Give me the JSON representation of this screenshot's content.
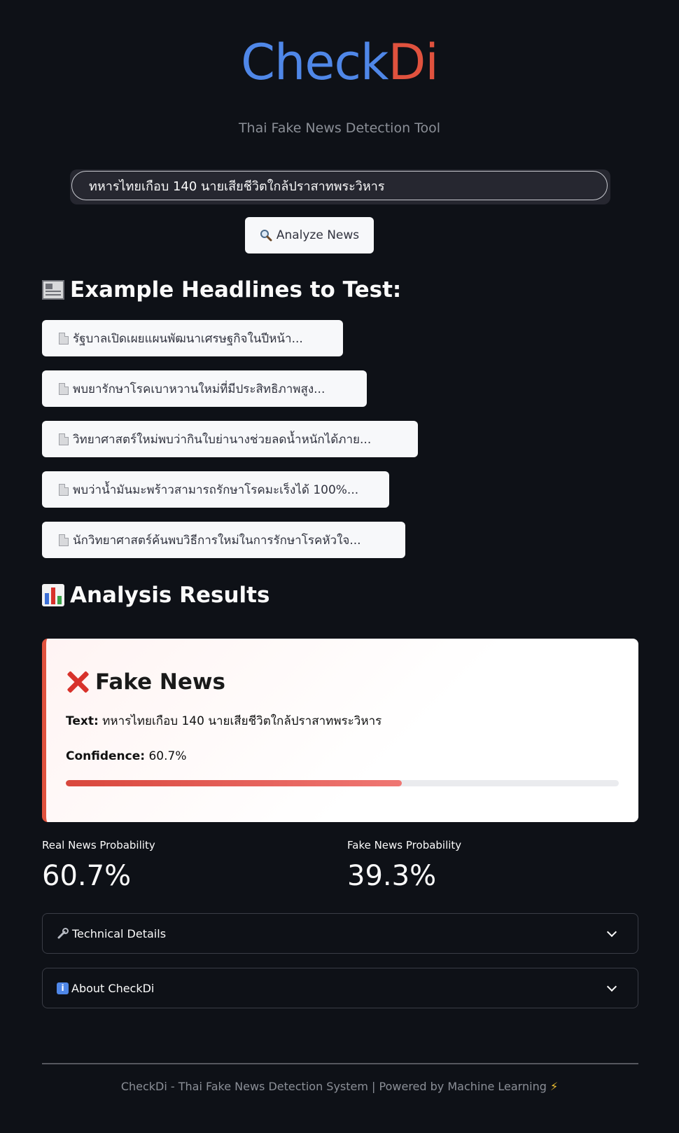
{
  "header": {
    "logo_part1": "Check",
    "logo_part2": "Di",
    "subtitle": "Thai Fake News Detection Tool",
    "logo_colors": {
      "check": "#4f87e8",
      "di": "#e0523e"
    }
  },
  "search": {
    "value": "ทหารไทยเกือบ 140 นายเสียชีวิตใกล้ปราสาทพระวิหาร"
  },
  "analyze_button": {
    "icon": "magnifier-icon",
    "label": "Analyze News"
  },
  "examples": {
    "title": "Example Headlines to Test:",
    "icon": "newspaper-icon",
    "items": [
      {
        "icon": "document-icon",
        "label": "รัฐบาลเปิดเผยแผนพัฒนาเศรษฐกิจในปีหน้า..."
      },
      {
        "icon": "document-icon",
        "label": "พบยารักษาโรคเบาหวานใหม่ที่มีประสิทธิภาพสูง..."
      },
      {
        "icon": "document-icon",
        "label": "วิทยาศาสตร์ใหม่พบว่ากินใบย่านางช่วยลดน้ำหนักได้ภาย..."
      },
      {
        "icon": "document-icon",
        "label": "พบว่าน้ำมันมะพร้าวสามารถรักษาโรคมะเร็งได้ 100%..."
      },
      {
        "icon": "document-icon",
        "label": "นักวิทยาศาสตร์ค้นพบวิธีการใหม่ในการรักษาโรคหัวใจ..."
      }
    ]
  },
  "results": {
    "title": "Analysis Results",
    "icon": "bar-chart-icon",
    "verdict": "Fake News",
    "verdict_icon": "cross-mark-icon",
    "text_label": "Text:",
    "text_value": "ทหารไทยเกือบ 140 นายเสียชีวิตใกล้ปราสาทพระวิหาร",
    "confidence_label": "Confidence:",
    "confidence_value": "60.7%",
    "confidence_fraction": 0.607,
    "accent_color": "#e0523e"
  },
  "metrics": {
    "real_label": "Real News Probability",
    "real_value": "60.7%",
    "fake_label": "Fake News Probability",
    "fake_value": "39.3%"
  },
  "expanders": {
    "technical": {
      "icon": "wrench-icon",
      "label": "Technical Details"
    },
    "about": {
      "icon": "info-icon",
      "label": "About CheckDi"
    }
  },
  "footer": {
    "text": "CheckDi - Thai Fake News Detection System | Powered by Machine Learning",
    "icon": "lightning-icon"
  }
}
